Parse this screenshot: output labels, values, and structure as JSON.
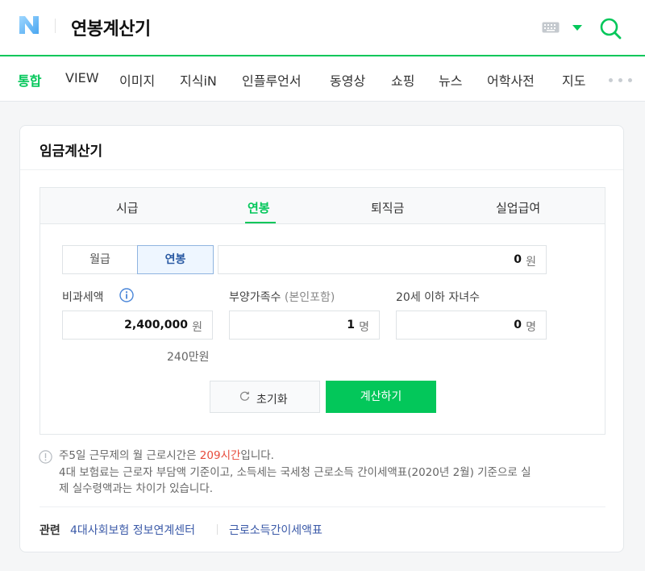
{
  "header": {
    "query": "연봉계산기"
  },
  "tabs": [
    {
      "label": "통합",
      "active": true
    },
    {
      "label": "VIEW"
    },
    {
      "label": "이미지"
    },
    {
      "label": "지식iN"
    },
    {
      "label": "인플루언서"
    },
    {
      "label": "동영상"
    },
    {
      "label": "쇼핑"
    },
    {
      "label": "뉴스"
    },
    {
      "label": "어학사전"
    },
    {
      "label": "지도"
    }
  ],
  "card": {
    "title": "임금계산기",
    "calc_tabs": [
      {
        "label": "시급"
      },
      {
        "label": "연봉",
        "active": true
      },
      {
        "label": "퇴직금"
      },
      {
        "label": "실업급여"
      }
    ],
    "pay_type": {
      "monthly": "월급",
      "annual": "연봉",
      "selected": "연봉"
    },
    "salary": {
      "value": "0",
      "unit": "원"
    },
    "nontax": {
      "label": "비과세액",
      "value": "2,400,000",
      "unit": "원",
      "hint": "240만원"
    },
    "dependents": {
      "label": "부양가족수",
      "sub": "(본인포함)",
      "value": "1",
      "unit": "명"
    },
    "children": {
      "label": "20세 이하 자녀수",
      "value": "0",
      "unit": "명"
    },
    "reset_label": "초기화",
    "calc_label": "계산하기"
  },
  "notes": {
    "line1_pre": "주5일 근무제의 월 근로시간은 ",
    "line1_hl": "209시간",
    "line1_post": "입니다.",
    "line2": "4대 보험료는 근로자 부담액 기준이고, 소득세는 국세청 근로소득 간이세액표(2020년 2월) 기준으로 실",
    "line3": "제 실수령액과는 차이가 있습니다."
  },
  "related": {
    "label": "관련",
    "links": [
      "4대사회보험 정보연계센터",
      "근로소득간이세액표"
    ]
  },
  "colors": {
    "accent": "#03c75a",
    "highlight": "#e74c3c",
    "link": "#3b5aa8"
  }
}
